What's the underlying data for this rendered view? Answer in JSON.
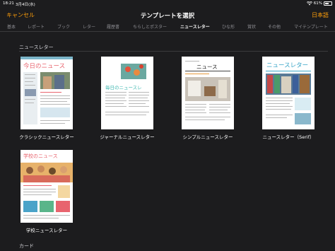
{
  "status": {
    "time": "18:21",
    "date": "3月4日(水)",
    "battery": "61%",
    "battery_level": 0.61
  },
  "nav": {
    "cancel": "キャンセル",
    "title": "テンプレートを選択",
    "language": "日本語"
  },
  "tabs": [
    {
      "label": "基本"
    },
    {
      "label": "レポート"
    },
    {
      "label": "ブック"
    },
    {
      "label": "レター"
    },
    {
      "label": "履歴書"
    },
    {
      "label": "ちらしとポスター"
    },
    {
      "label": "ニュースレター"
    },
    {
      "label": "ひな形"
    },
    {
      "label": "賞状"
    },
    {
      "label": "その他"
    },
    {
      "label": "マイテンプレート"
    }
  ],
  "active_tab": "ニュースレター",
  "sections": {
    "newsletter": "ニュースレター",
    "card": "カード"
  },
  "templates": [
    {
      "label": "クラシックニュースレター",
      "masthead": "今日のニュース"
    },
    {
      "label": "ジャーナルニュースレター",
      "masthead": "毎日のニュースレ"
    },
    {
      "label": "シンプルニュースレター",
      "masthead": "ニュース"
    },
    {
      "label": "ニュースレター（Serif）",
      "masthead": "ニュースレター"
    },
    {
      "label": "学校ニュースレター",
      "masthead": "学校のニュース"
    }
  ],
  "colors": {
    "accent": "#ff9f0a",
    "background": "#1c1c1e"
  }
}
